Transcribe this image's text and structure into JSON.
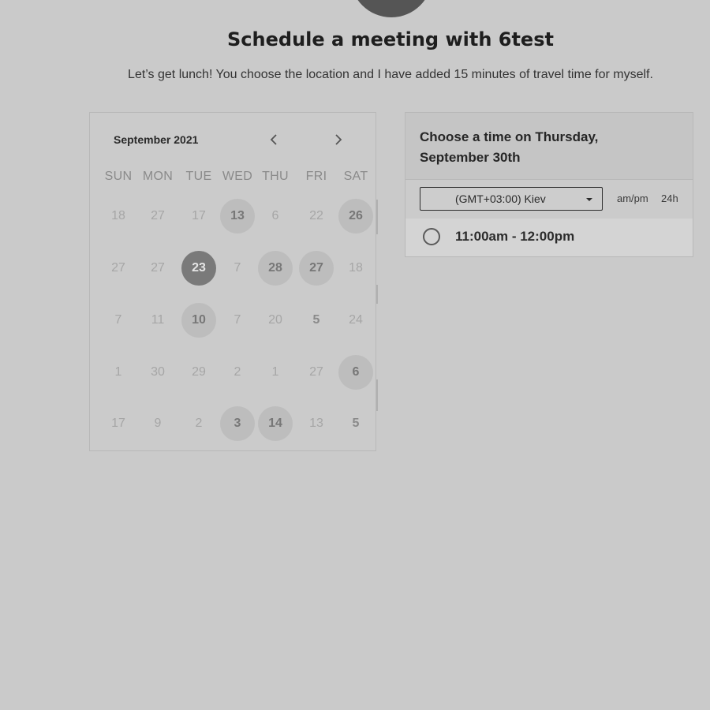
{
  "page": {
    "title": "Schedule a meeting with 6test",
    "subtitle": "Let’s get lunch! You choose the location and I have added 15 minutes of travel time for myself."
  },
  "calendar": {
    "month_label": "September 2021",
    "prev_icon": "chevron-left-icon",
    "next_icon": "chevron-right-icon",
    "weekdays": [
      "SUN",
      "MON",
      "TUE",
      "WED",
      "THU",
      "FRI",
      "SAT"
    ],
    "weeks": [
      [
        {
          "d": "18",
          "s": "muted"
        },
        {
          "d": "27",
          "s": "muted"
        },
        {
          "d": "17",
          "s": "muted"
        },
        {
          "d": "13",
          "s": "available"
        },
        {
          "d": "6",
          "s": "muted"
        },
        {
          "d": "22",
          "s": "muted"
        },
        {
          "d": "26",
          "s": "available"
        }
      ],
      [
        {
          "d": "27",
          "s": "muted"
        },
        {
          "d": "27",
          "s": "muted"
        },
        {
          "d": "23",
          "s": "selected"
        },
        {
          "d": "7",
          "s": "muted"
        },
        {
          "d": "28",
          "s": "available"
        },
        {
          "d": "27",
          "s": "available"
        },
        {
          "d": "18",
          "s": "muted"
        }
      ],
      [
        {
          "d": "7",
          "s": "muted"
        },
        {
          "d": "11",
          "s": "muted"
        },
        {
          "d": "10",
          "s": "available"
        },
        {
          "d": "7",
          "s": "muted"
        },
        {
          "d": "20",
          "s": "muted"
        },
        {
          "d": "5",
          "s": "bold"
        },
        {
          "d": "24",
          "s": "muted"
        }
      ],
      [
        {
          "d": "1",
          "s": "muted"
        },
        {
          "d": "30",
          "s": "muted"
        },
        {
          "d": "29",
          "s": "muted"
        },
        {
          "d": "2",
          "s": "muted"
        },
        {
          "d": "1",
          "s": "muted"
        },
        {
          "d": "27",
          "s": "muted"
        },
        {
          "d": "6",
          "s": "available"
        }
      ],
      [
        {
          "d": "17",
          "s": "muted"
        },
        {
          "d": "9",
          "s": "muted"
        },
        {
          "d": "2",
          "s": "muted"
        },
        {
          "d": "3",
          "s": "available"
        },
        {
          "d": "14",
          "s": "available"
        },
        {
          "d": "13",
          "s": "muted"
        },
        {
          "d": "5",
          "s": "bold"
        }
      ]
    ]
  },
  "time_panel": {
    "heading": "Choose a time on Thursday, September 30th",
    "timezone": "(GMT+03:00) Kiev",
    "format_ampm": "am/pm",
    "format_24h": "24h",
    "slots": [
      "11:00am - 12:00pm"
    ]
  },
  "colors": {
    "background": "#cacaca",
    "selected_day": "#7a7a7a",
    "available_day": "#bdbdbd"
  }
}
